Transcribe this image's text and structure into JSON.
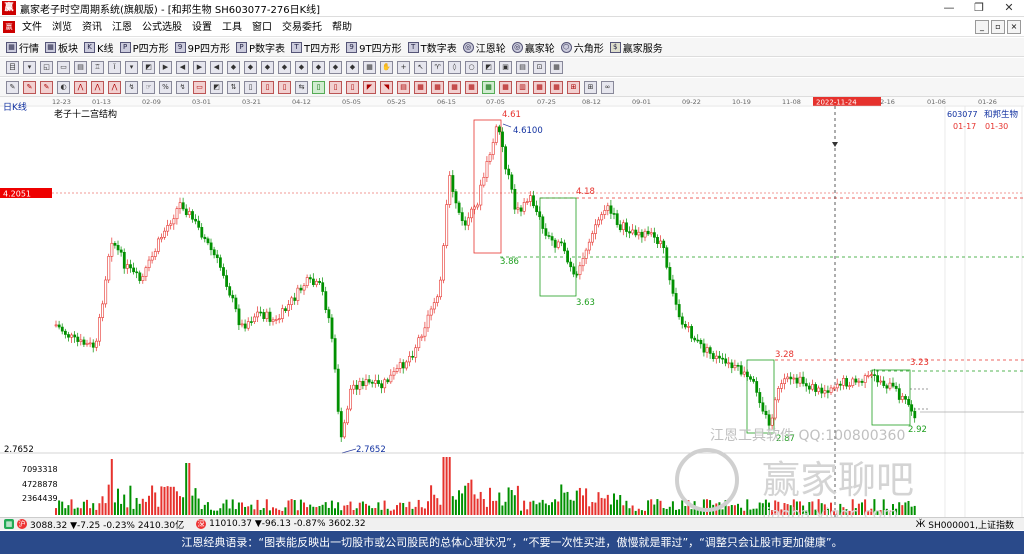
{
  "window": {
    "title": "赢家老子时空周期系统(旗舰版) - [和邦生物  SH603077-276日K线]"
  },
  "menu": [
    "文件",
    "浏览",
    "资讯",
    "江恩",
    "公式选股",
    "设置",
    "工具",
    "窗口",
    "交易委托",
    "帮助"
  ],
  "toolbar1": [
    {
      "label": "行情",
      "icon": "grid-icon"
    },
    {
      "label": "板块",
      "icon": "grid-icon"
    },
    {
      "label": "K线",
      "icon": "k-icon"
    },
    {
      "label": "P四方形",
      "icon": "p-icon"
    },
    {
      "label": "9P四方形",
      "icon": "9p-icon"
    },
    {
      "label": "P数字表",
      "icon": "p-icon"
    },
    {
      "label": "T四方形",
      "icon": "t-icon"
    },
    {
      "label": "9T四方形",
      "icon": "9t-icon"
    },
    {
      "label": "T数字表",
      "icon": "tn-icon"
    },
    {
      "label": "江恩轮",
      "icon": "wheel-icon"
    },
    {
      "label": "赢家轮",
      "icon": "wheel-icon"
    },
    {
      "label": "六角形",
      "icon": "hexagon-icon"
    },
    {
      "label": "赢家服务",
      "icon": "dollar-icon"
    }
  ],
  "colors": {
    "up": "#e6322d",
    "down": "#009000",
    "dash_red": "#e6322d",
    "dash_green": "#1e9f1e",
    "box_green": "#1e9f1e",
    "box_red": "#e6322d",
    "label_blue": "#1030a0"
  },
  "chart": {
    "date_axis": [
      "12-23",
      "01-13",
      "02-09",
      "03-01",
      "03-21",
      "04-12",
      "05-05",
      "05-25",
      "06-15",
      "07-05",
      "07-25",
      "08-12",
      "09-01",
      "09-22",
      "10-19",
      "11-08",
      "2022-11-24",
      "12-16",
      "01-06",
      "01-26"
    ],
    "panel_label": "日K线",
    "indicator_label": "老子十二宫结构",
    "stock_code": "603077",
    "stock_name": "和邦生物",
    "date_range_start": "01-17",
    "date_range_end": "01-30",
    "price_tag": "4.2051",
    "low_price_label": "2.7652",
    "low_price_annot": "2.7652",
    "volume_labels": [
      "7093318",
      "4728878",
      "2364439"
    ],
    "annotations": [
      {
        "text": "4.61",
        "color": "red"
      },
      {
        "text": "4.6100",
        "color": "blue"
      },
      {
        "text": "4.18",
        "color": "red"
      },
      {
        "text": "3.86",
        "color": "green"
      },
      {
        "text": "3.63",
        "color": "green"
      },
      {
        "text": "3.28",
        "color": "red"
      },
      {
        "text": "3.23",
        "color": "red"
      },
      {
        "text": "2.87",
        "color": "green"
      },
      {
        "text": "2.92",
        "color": "green"
      }
    ],
    "watermark1": "江恩工具软件  QQ:100800360",
    "watermark2": "赢家聊吧",
    "watermark3": "liaoba.yjqqc.com"
  },
  "chart_data": {
    "type": "candlestick",
    "title": "老子十二宫结构",
    "x_range": [
      "12-23",
      "01-26"
    ],
    "y_range": [
      2.7652,
      4.61
    ],
    "key_levels": [
      4.61,
      4.61,
      4.2051,
      4.18,
      3.86,
      3.63,
      3.28,
      3.23,
      2.92,
      2.87,
      2.7652
    ],
    "volume_levels": [
      2364439,
      4728878,
      7093318
    ]
  },
  "status": {
    "idx1": "3088.32 ▼-7.25 -0.23% 2410.30亿",
    "idx2": "11010.37 ▼-96.13 -0.87% 3602.32",
    "right": "SH000001,上证指数"
  },
  "quote": "江恩经典语录：“图表能反映出一切股市或公司股民的总体心理状况”，“不要一次性买进，傲慢就是罪过”，“调整只会让股市更加健康”。"
}
